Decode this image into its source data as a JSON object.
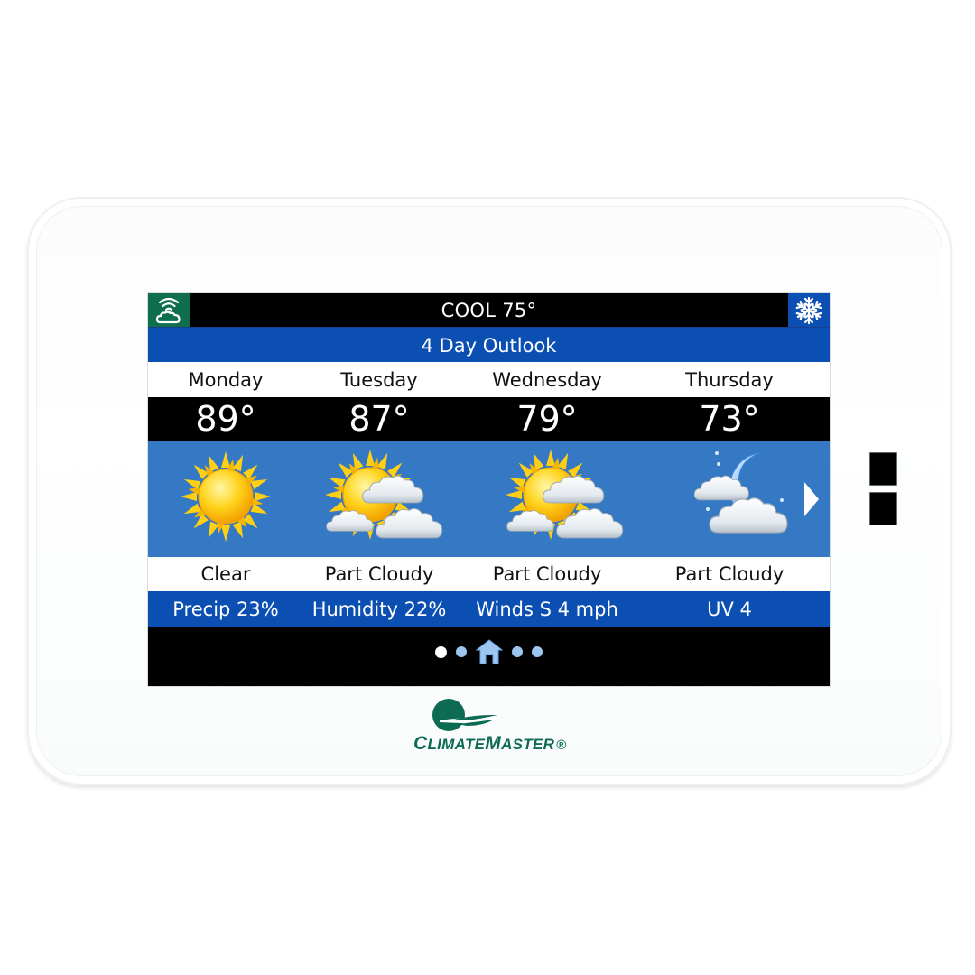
{
  "device": {
    "brand": {
      "first_initial": "C",
      "first_rest": "LIMATE",
      "second_initial": "M",
      "second_rest": "ASTER",
      "registered": "®"
    },
    "side_buttons": 2
  },
  "status_bar": {
    "mode_text": "COOL 75°",
    "left_icon": "wifi-cloud-icon",
    "right_icon": "snowflake-icon"
  },
  "title": "4 Day Outlook",
  "forecast": [
    {
      "day": "Monday",
      "temp": "89°",
      "icon": "sunny-icon",
      "condition": "Clear",
      "detail": "Precip 23%"
    },
    {
      "day": "Tuesday",
      "temp": "87°",
      "icon": "partly-cloudy-day-icon",
      "condition": "Part Cloudy",
      "detail": "Humidity 22%"
    },
    {
      "day": "Wednesday",
      "temp": "79°",
      "icon": "partly-cloudy-day-icon",
      "condition": "Part Cloudy",
      "detail": "Winds S 4 mph"
    },
    {
      "day": "Thursday",
      "temp": "73°",
      "icon": "partly-cloudy-night-icon",
      "condition": "Part Cloudy",
      "detail": "UV 4"
    }
  ],
  "nav": {
    "pages": [
      "page-1",
      "page-2",
      "home",
      "page-4",
      "page-5"
    ],
    "active_page": 1
  },
  "colors": {
    "title_blue": "#0b4fb3",
    "icon_area_blue": "#3579c4",
    "wifi_green": "#0f6e4d",
    "brand_green": "#0d6b54",
    "nav_dot": "#9cc6f0"
  }
}
